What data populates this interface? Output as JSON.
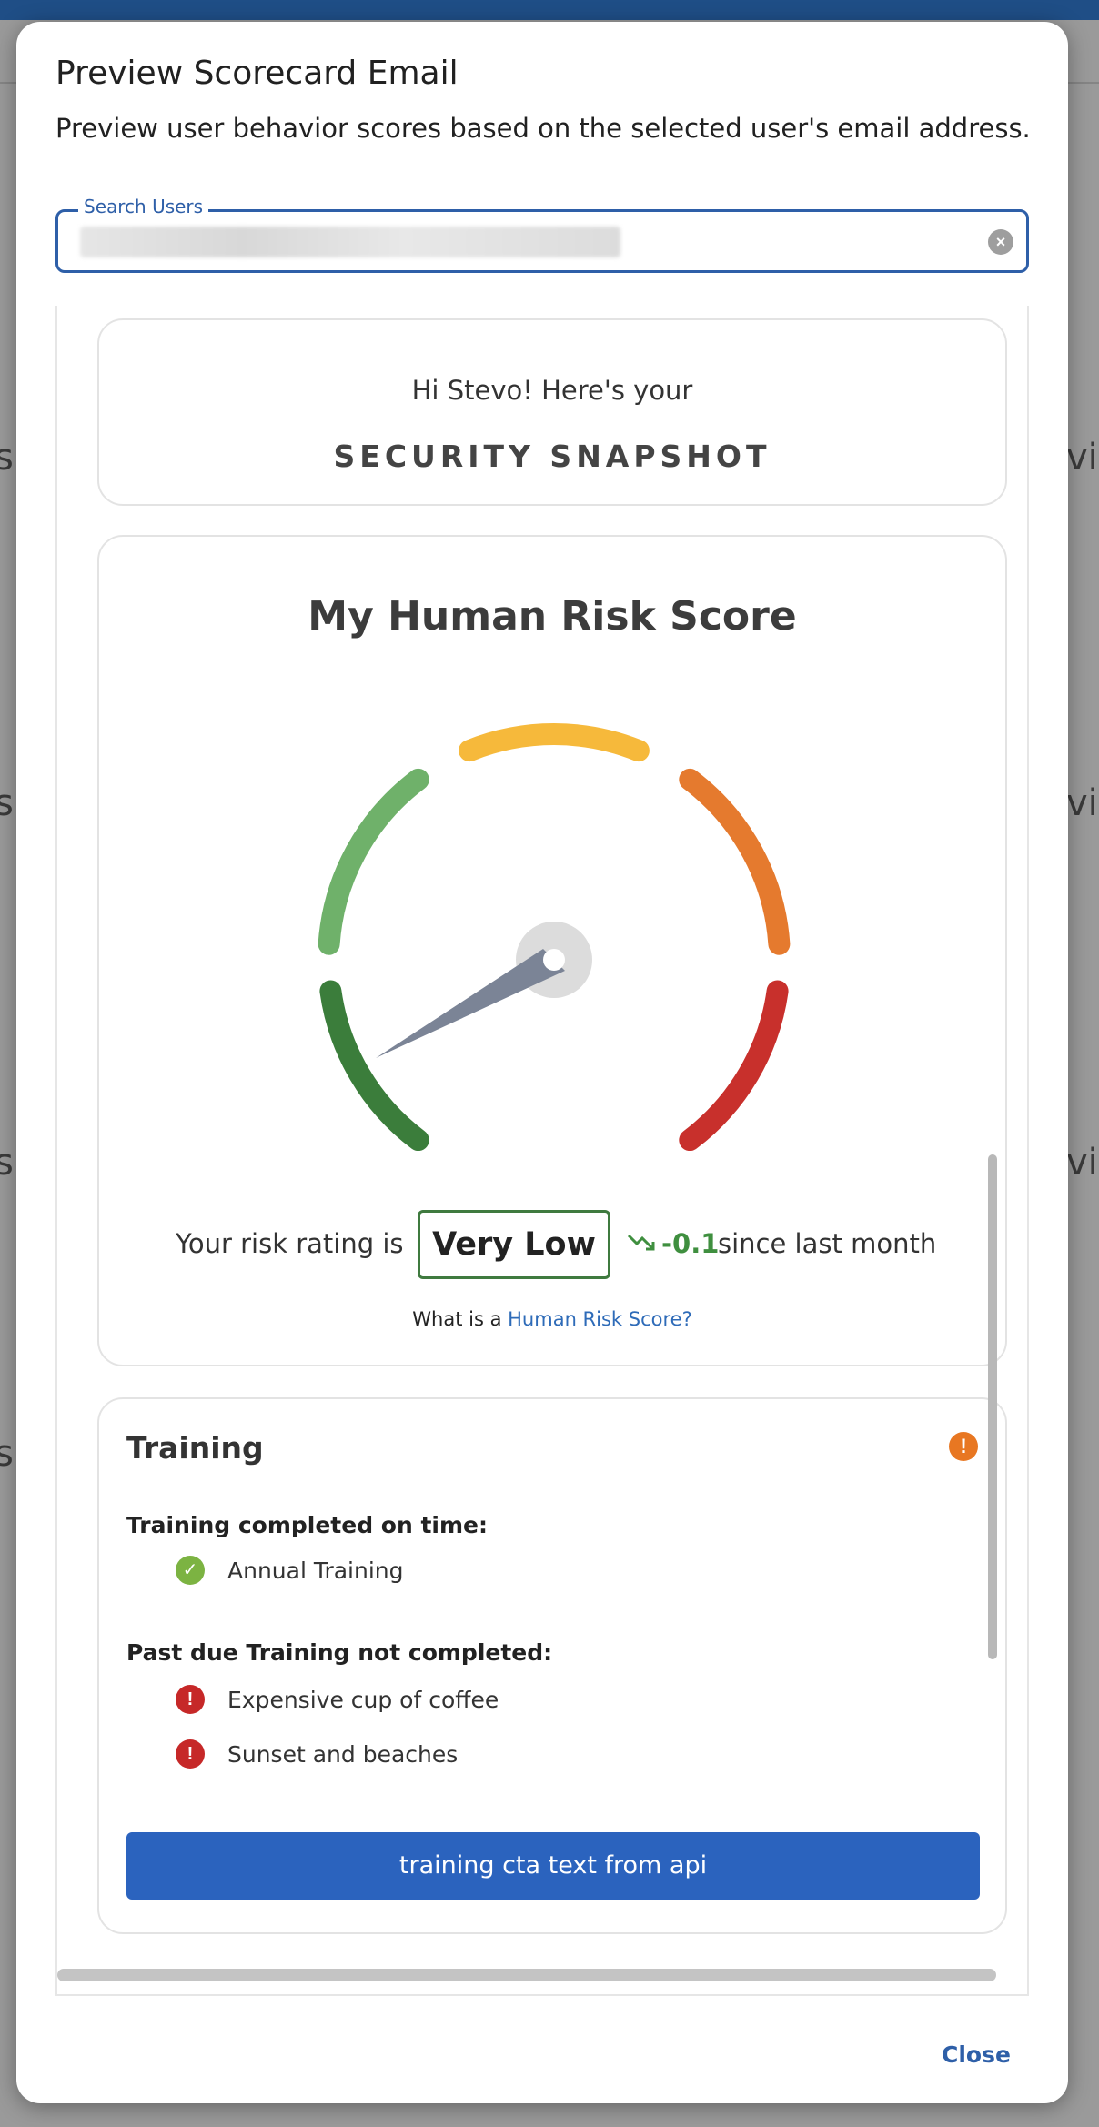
{
  "modal": {
    "title": "Preview Scorecard Email",
    "subtitle": "Preview user behavior scores based on the selected user's email address.",
    "close_label": "Close"
  },
  "search": {
    "label": "Search Users",
    "value": "",
    "clear_icon": "close-circle-icon"
  },
  "greeting_card": {
    "greeting": "Hi Stevo! Here's your",
    "heading": "SECURITY SNAPSHOT"
  },
  "risk_card": {
    "title": "My Human Risk Score",
    "gauge": {
      "segments": [
        {
          "name": "very-low",
          "color": "#3b7d3b"
        },
        {
          "name": "low",
          "color": "#6fb16a"
        },
        {
          "name": "medium",
          "color": "#f6b93b"
        },
        {
          "name": "high",
          "color": "#e57a2e"
        },
        {
          "name": "very-high",
          "color": "#c8302c"
        }
      ],
      "needle_color": "#7b8496"
    },
    "rating_prefix": "Your risk rating is",
    "rating": "Very Low",
    "trend_value": "-0.1",
    "trend_suffix": "since last month",
    "trend_icon": "trending-down-icon",
    "whatis_prefix": "What is a",
    "whatis_link": "Human Risk Score?"
  },
  "training_card": {
    "title": "Training",
    "status_icon": "warning-icon",
    "completed_label": "Training completed on time:",
    "completed_items": [
      "Annual Training"
    ],
    "pastdue_label": "Past due Training not completed:",
    "pastdue_items": [
      "Expensive cup of coffee",
      "Sunset and beaches"
    ],
    "cta_label": "training cta text from api"
  },
  "colors": {
    "accent": "#2b63be",
    "good": "#3f7a3f",
    "warning": "#e87722",
    "danger": "#c62828"
  }
}
